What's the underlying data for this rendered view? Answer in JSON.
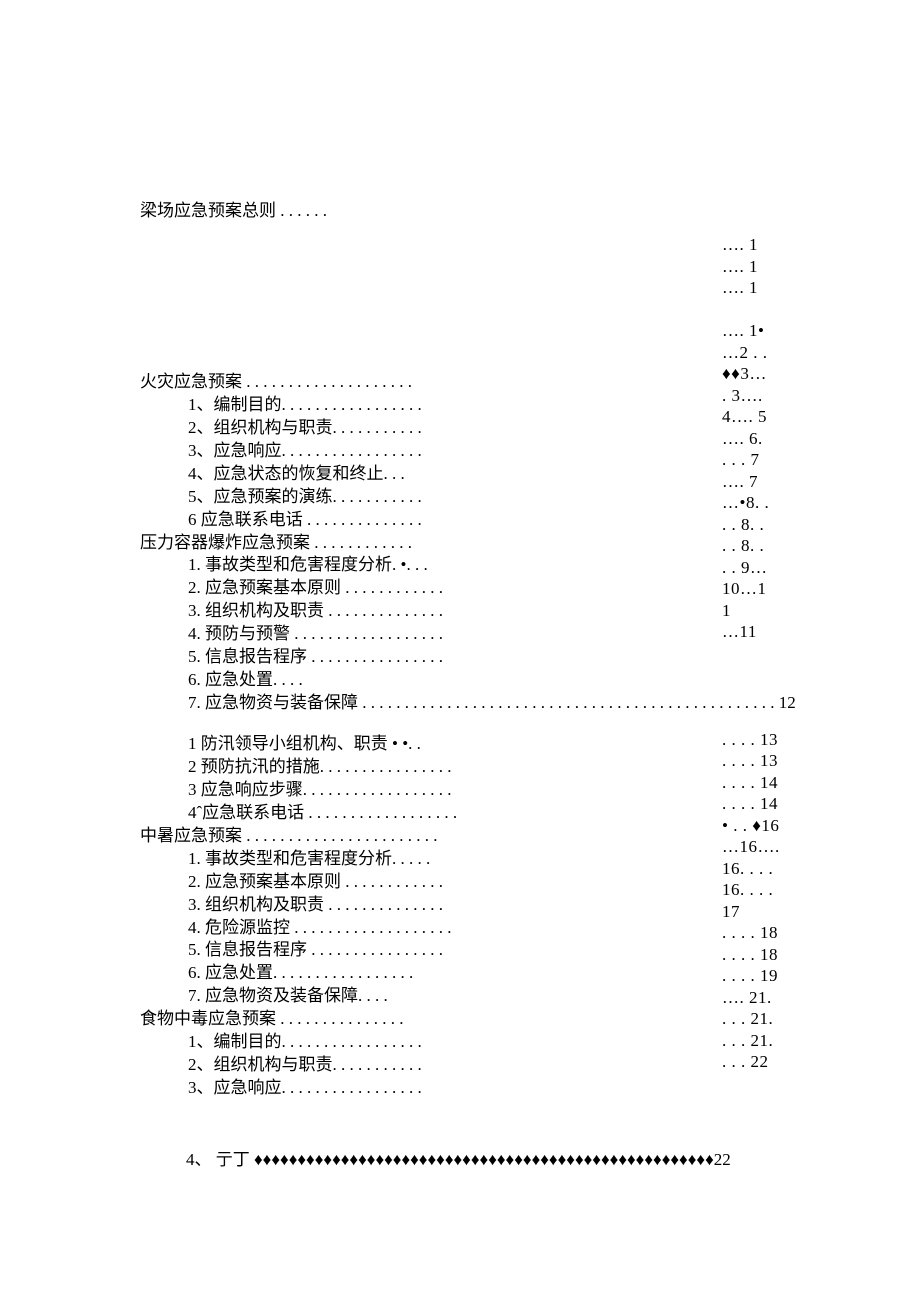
{
  "title": "梁场应急预案总则 . . . . . .",
  "rightcol": [
    "…. 1",
    "…. 1",
    "…. 1",
    "",
    "…. 1•",
    "…2 .  .",
    "♦♦3…",
    ". 3…. ",
    "4…. 5",
    "…. 6.",
    ". . . 7",
    "…. 7",
    "…•8. .",
    ". . 8. .",
    ". . 8. .",
    ". . 9…",
    "10…1",
    "1",
    "…11",
    "",
    "",
    "",
    "",
    ". . . . 13",
    ". . . . 13",
    ". . . . 14",
    ". . . . 14",
    "• . . ♦16",
    "…16…. ",
    "16. . . . ",
    "16. . . . ",
    "17",
    ". . . . 18",
    ". . . . 18",
    ". . . . 19",
    "…. 21.",
    ". . . 21.",
    ". . . 21.",
    ". . . 22"
  ],
  "lines": [
    {
      "cls": "ind0",
      "text": "火灾应急预案 . . . . . . . . . . . . . . . . . . . ."
    },
    {
      "cls": "ind1",
      "text": "1、编制目的. . . . . . . . . . . . . . . . ."
    },
    {
      "cls": "ind1",
      "text": "2、组织机构与职责. . . . . . . . . . ."
    },
    {
      "cls": "ind1",
      "text": "3、应急响应. . . . . . . . . . . . . . . . ."
    },
    {
      "cls": "ind1",
      "text": "4、应急状态的恢复和终止. . ."
    },
    {
      "cls": "ind1",
      "text": "5、应急预案的演练. . . . . . . . . . ."
    },
    {
      "cls": "ind1",
      "text": "6 应急联系电话 . . . . . . . . . . . . . ."
    },
    {
      "cls": "ind0",
      "text": "压力容器爆炸应急预案 . . . . . . . . . . . ."
    },
    {
      "cls": "ind1",
      "text": "1.   事故类型和危害程度分析.  •. . ."
    },
    {
      "cls": "ind1",
      "text": "2.   应急预案基本原则 . . . . . . . . . . . ."
    },
    {
      "cls": "ind1",
      "text": "3.   组织机构及职责 . . . . . . . . . . . . . ."
    },
    {
      "cls": "ind1",
      "text": "4.   预防与预警 . . . . . . . . . . . . . . . . . ."
    },
    {
      "cls": "ind1",
      "text": "5.   信息报告程序 . . . . . . . . . . . . . . . ."
    },
    {
      "cls": "ind1",
      "text": "6. 应急处置. . . ."
    },
    {
      "cls": "ind1 full",
      "text": "7. 应急物资与装备保障 . . . . . . . . . . . . . . . . . . . . . . . . . . . . . . . . . . . . . . . . . . . . . . . . . 12"
    },
    {
      "cls": "gap",
      "text": ""
    },
    {
      "cls": "ind1",
      "text": "1 防汛领导小组机构、职责 • •. ."
    },
    {
      "cls": "ind1",
      "text": "2 预防抗汛的措施. . . . . . . . . . . . . . . ."
    },
    {
      "cls": "ind1",
      "text": "3 应急响应步骤. . . . . . . . . . . . . . . . . ."
    },
    {
      "cls": "ind1",
      "text": "4ˆ应急联系电话 . . . . . . . . . . . . . . . . . ."
    },
    {
      "cls": "ind0",
      "text": "中暑应急预案 . . . . . . . . . . . . . . . . . . . . . . ."
    },
    {
      "cls": "ind1",
      "text": "1.   事故类型和危害程度分析. . . . ."
    },
    {
      "cls": "ind1",
      "text": "2.   应急预案基本原则 . . . . . . . . . . . ."
    },
    {
      "cls": "ind1",
      "text": "3.   组织机构及职责 . . . . . . . . . . . . . ."
    },
    {
      "cls": "ind1",
      "text": "4.   危险源监控 . . . . . . . . . . . . . . . . . . ."
    },
    {
      "cls": "ind1",
      "text": "5.   信息报告程序 . . . . . . . . . . . . . . . ."
    },
    {
      "cls": "ind1",
      "text": "6. 应急处置. . . . . . . . . . . . . . . . ."
    },
    {
      "cls": "ind1",
      "text": "7. 应急物资及装备保障. . . ."
    },
    {
      "cls": "ind0",
      "text": "食物中毒应急预案 . . . . . . . . . . . . . . ."
    },
    {
      "cls": "ind1",
      "text": "1、编制目的. . . . . . . . . . . . . . . . ."
    },
    {
      "cls": "ind1",
      "text": "2、组织机构与职责. . . . . . . . . . ."
    },
    {
      "cls": "ind1",
      "text": "3、应急响应. . . . . . . . . . . . . . . . ."
    }
  ],
  "bottom": "4、  亍丁 ♦♦♦♦♦♦♦♦♦♦♦♦♦♦♦♦♦♦♦♦♦♦♦♦♦♦♦♦♦♦♦♦♦♦♦♦♦♦♦♦♦♦♦♦♦♦♦♦♦♦♦♦♦22"
}
